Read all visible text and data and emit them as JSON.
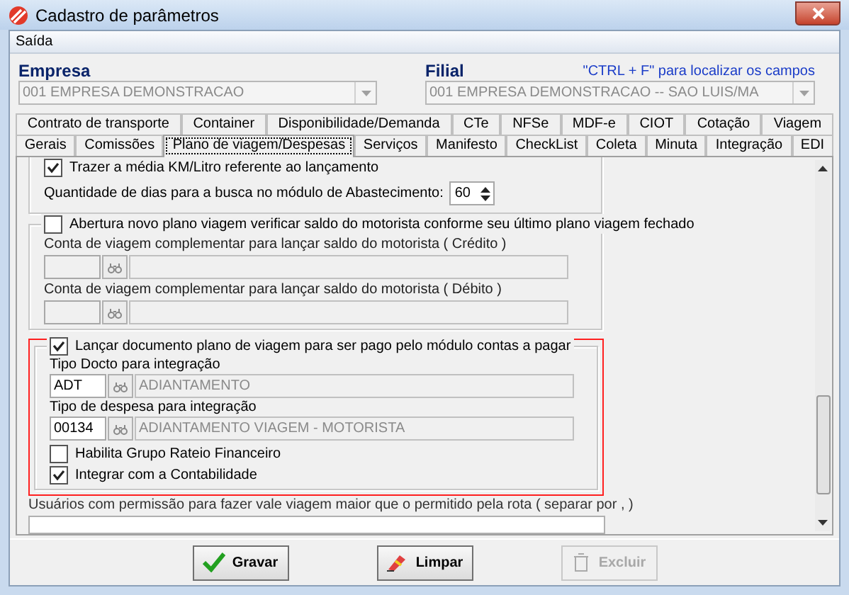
{
  "window": {
    "title": "Cadastro de parâmetros"
  },
  "menu": [
    {
      "label": "Saída"
    }
  ],
  "header": {
    "empresa": {
      "label": "Empresa",
      "value": "001 EMPRESA DEMONSTRACAO"
    },
    "filial": {
      "label": "Filial",
      "value": "001 EMPRESA DEMONSTRACAO -- SAO LUIS/MA"
    },
    "hint": "\"CTRL + F\" para localizar os campos"
  },
  "tab_rows": [
    [
      {
        "label": "Contrato de transporte",
        "selected": false
      },
      {
        "label": "Container",
        "selected": false
      },
      {
        "label": "Disponibilidade/Demanda",
        "selected": false
      },
      {
        "label": "CTe",
        "selected": false
      },
      {
        "label": "NFSe",
        "selected": false
      },
      {
        "label": "MDF-e",
        "selected": false
      },
      {
        "label": "CIOT",
        "selected": false
      },
      {
        "label": "Cotação",
        "selected": false
      },
      {
        "label": "Viagem",
        "selected": false
      }
    ],
    [
      {
        "label": "Gerais",
        "selected": false
      },
      {
        "label": "Comissões",
        "selected": false
      },
      {
        "label": "Plano de viagem/Despesas",
        "selected": true
      },
      {
        "label": "Serviços",
        "selected": false
      },
      {
        "label": "Manifesto",
        "selected": false
      },
      {
        "label": "CheckList",
        "selected": false
      },
      {
        "label": "Coleta",
        "selected": false
      },
      {
        "label": "Minuta",
        "selected": false
      },
      {
        "label": "Integração",
        "selected": false
      },
      {
        "label": "EDI",
        "selected": false
      }
    ]
  ],
  "media_group": {
    "checkbox": {
      "label": "Trazer a média KM/Litro referente ao lançamento",
      "checked": true
    },
    "days_label": "Quantidade de dias para a busca no módulo de Abastecimento:",
    "days_value": "60"
  },
  "saldo_group": {
    "checkbox": {
      "label": "Abertura novo plano viagem verificar saldo do motorista conforme seu último plano viagem fechado",
      "checked": false
    },
    "fields": [
      {
        "label": "Conta de viagem complementar para lançar saldo do motorista ( Crédito )"
      },
      {
        "label": "Conta de viagem complementar para lançar saldo do motorista ( Débito )"
      }
    ]
  },
  "contas_group": {
    "highlighted": true,
    "checkbox": {
      "label": "Lançar documento plano de viagem para ser pago pelo módulo contas a pagar",
      "checked": true
    },
    "fields": [
      {
        "label": "Tipo Docto para integração",
        "code": "ADT",
        "description": "ADIANTAMENTO"
      },
      {
        "label": "Tipo de despesa para integração",
        "code": "00134",
        "description": "ADIANTAMENTO VIAGEM -  MOTORISTA"
      }
    ],
    "options": [
      {
        "label": "Habilita Grupo Rateio Financeiro",
        "checked": false
      },
      {
        "label": "Integrar com a Contabilidade",
        "checked": true
      }
    ]
  },
  "users": {
    "label": "Usuários com permissão para fazer vale viagem maior que o permitido pela rota ( separar por , )"
  },
  "buttons": [
    {
      "label": "Gravar",
      "kind": "save",
      "disabled": false
    },
    {
      "label": "Limpar",
      "kind": "clear",
      "disabled": false
    },
    {
      "label": "Excluir",
      "kind": "delete",
      "disabled": true
    }
  ]
}
